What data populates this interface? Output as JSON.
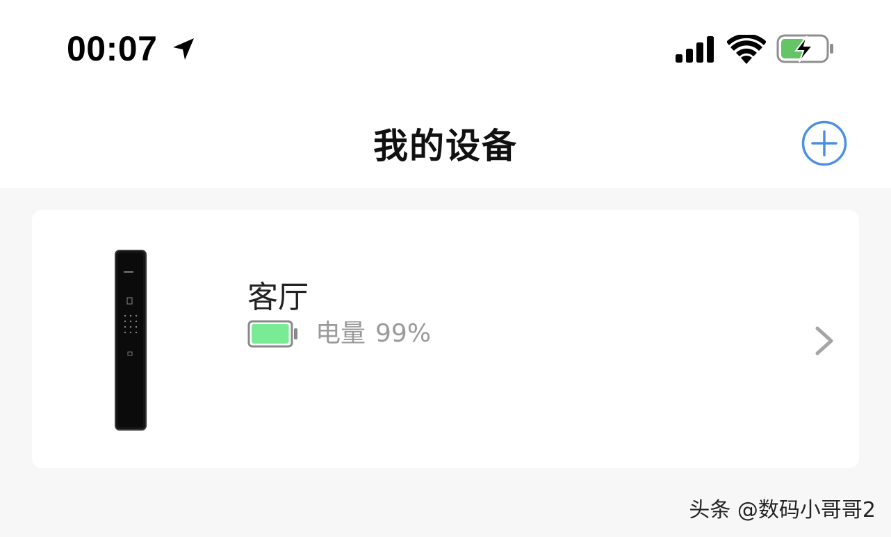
{
  "status_bar": {
    "time": "00:07",
    "location_icon": "location-arrow-icon",
    "signal_icon": "cellular-signal-icon",
    "wifi_icon": "wifi-icon",
    "battery_icon": "battery-charging-icon"
  },
  "header": {
    "title": "我的设备",
    "add_icon": "plus-circle-icon"
  },
  "devices": [
    {
      "name": "客厅",
      "battery_label": "电量",
      "battery_value": "99%",
      "battery_level": 0.99,
      "image_icon": "smart-door-lock-icon",
      "chevron_icon": "chevron-right-icon"
    }
  ],
  "watermark": "头条 @数码小哥哥2",
  "colors": {
    "accent": "#4a90e2",
    "battery_fill": "#7aeb95",
    "card_background": "#ffffff",
    "page_background": "#f7f7f7",
    "secondary_text": "#9a9a9a",
    "status_battery_fill": "#65c466"
  }
}
